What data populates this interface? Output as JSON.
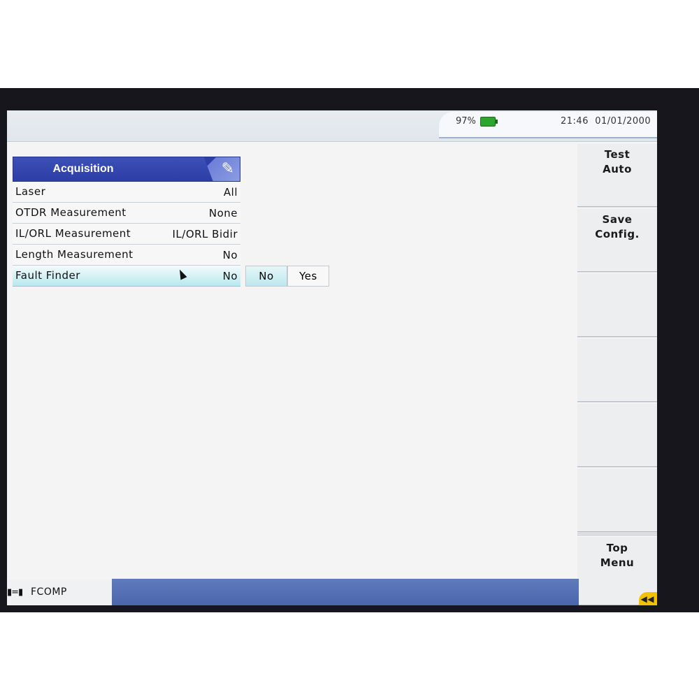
{
  "status": {
    "battery": "97%",
    "time": "21:46",
    "date": "01/01/2000"
  },
  "panel": {
    "title": "Acquisition",
    "rows": [
      {
        "label": "Laser",
        "value": "All"
      },
      {
        "label": "OTDR Measurement",
        "value": "None"
      },
      {
        "label": "IL/ORL Measurement",
        "value": "IL/ORL Bidir"
      },
      {
        "label": "Length Measurement",
        "value": "No"
      },
      {
        "label": "Fault Finder",
        "value": "No"
      }
    ]
  },
  "choices": {
    "options": [
      "No",
      "Yes"
    ],
    "selected": "No"
  },
  "side_menu": {
    "test_auto": [
      "Test",
      "Auto"
    ],
    "save_config": [
      "Save",
      "Config."
    ],
    "top_menu": [
      "Top",
      "Menu"
    ]
  },
  "bottom": {
    "connector_glyph": "▮=▮",
    "module": "FCOMP"
  },
  "colors": {
    "header": "#2d3ea6",
    "selected_row": "#b8e8ee",
    "bottom_bar": "#4b66ac",
    "battery": "#2ea52e"
  },
  "icons": [
    "battery-icon",
    "edit-icon",
    "cursor-icon",
    "connector-icon",
    "back-icon"
  ]
}
